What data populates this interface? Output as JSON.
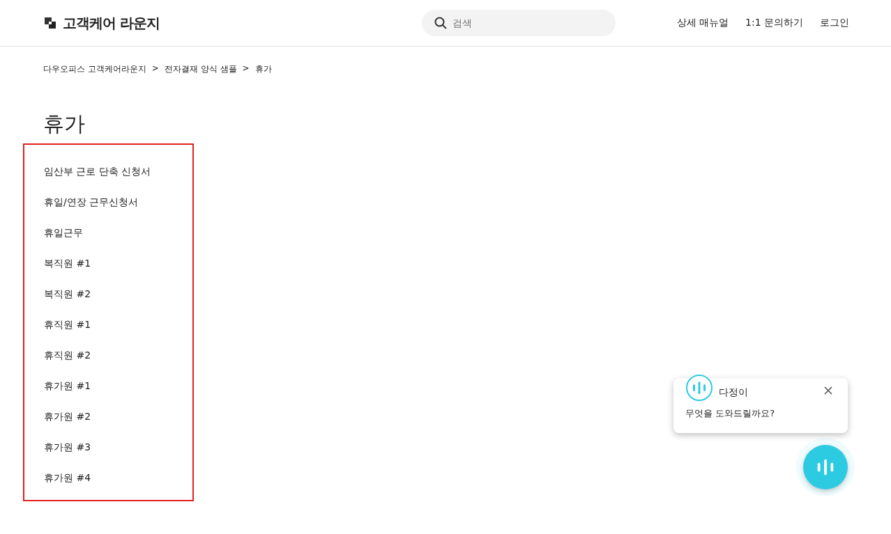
{
  "header": {
    "logo_text": "고객케어 라운지",
    "search": {
      "placeholder": "검색"
    },
    "nav": [
      "상세 매뉴얼",
      "1:1 문의하기",
      "로그인"
    ]
  },
  "breadcrumb": [
    "다우오피스 고객케어라운지",
    ">",
    "전자결재 양식 샘플",
    ">",
    "휴가"
  ],
  "title": "휴가",
  "list": {
    "highlighted": true,
    "items": [
      "임산부 근로 단축 신청서",
      "휴일/연장 근무신청서",
      "휴일근무",
      "복직원 #1",
      "복직원 #2",
      "휴직원 #1",
      "휴직원 #2",
      "휴가원 #1",
      "휴가원 #2",
      "휴가원 #3",
      "휴가원 #4"
    ]
  },
  "chat": {
    "name": "다정이",
    "message": "무엇을 도와드릴까요?"
  }
}
